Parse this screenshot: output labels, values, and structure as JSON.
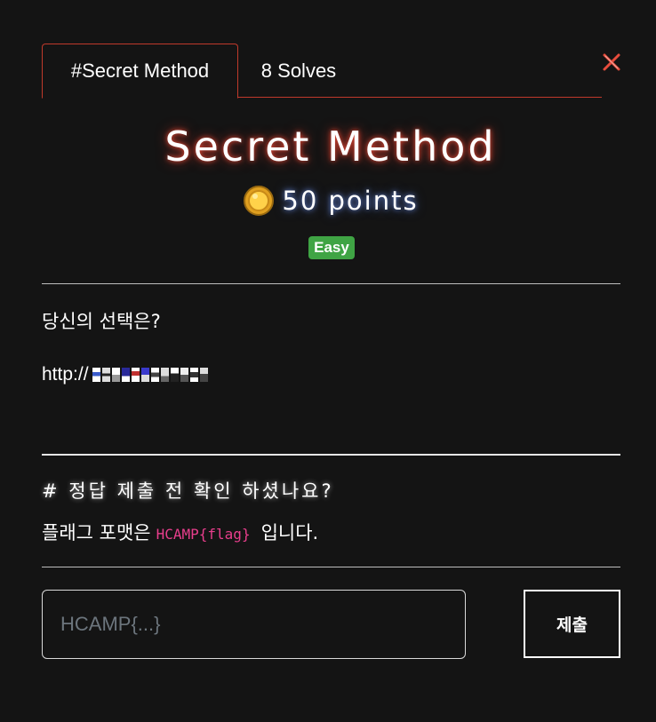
{
  "tabs": {
    "challenge_label": "#Secret Method",
    "solves_label": "8 Solves"
  },
  "challenge": {
    "title": "Secret Method",
    "points_label": "50 points",
    "difficulty": "Easy",
    "description": "당신의 선택은?",
    "url_prefix": "http://"
  },
  "notice": {
    "heading": "# 정답 제출 전 확인 하셨나요?",
    "prefix": "플래그 포맷은",
    "format_code": "HCAMP{flag}",
    "suffix": "입니다."
  },
  "form": {
    "placeholder": "HCAMP{...}",
    "submit_label": "제출"
  },
  "colors": {
    "accent_border": "#c0392b",
    "badge_easy": "#3fa444",
    "code_pink": "#e83e8c"
  },
  "icons": {
    "close": "close-icon",
    "coin": "coin-icon"
  }
}
